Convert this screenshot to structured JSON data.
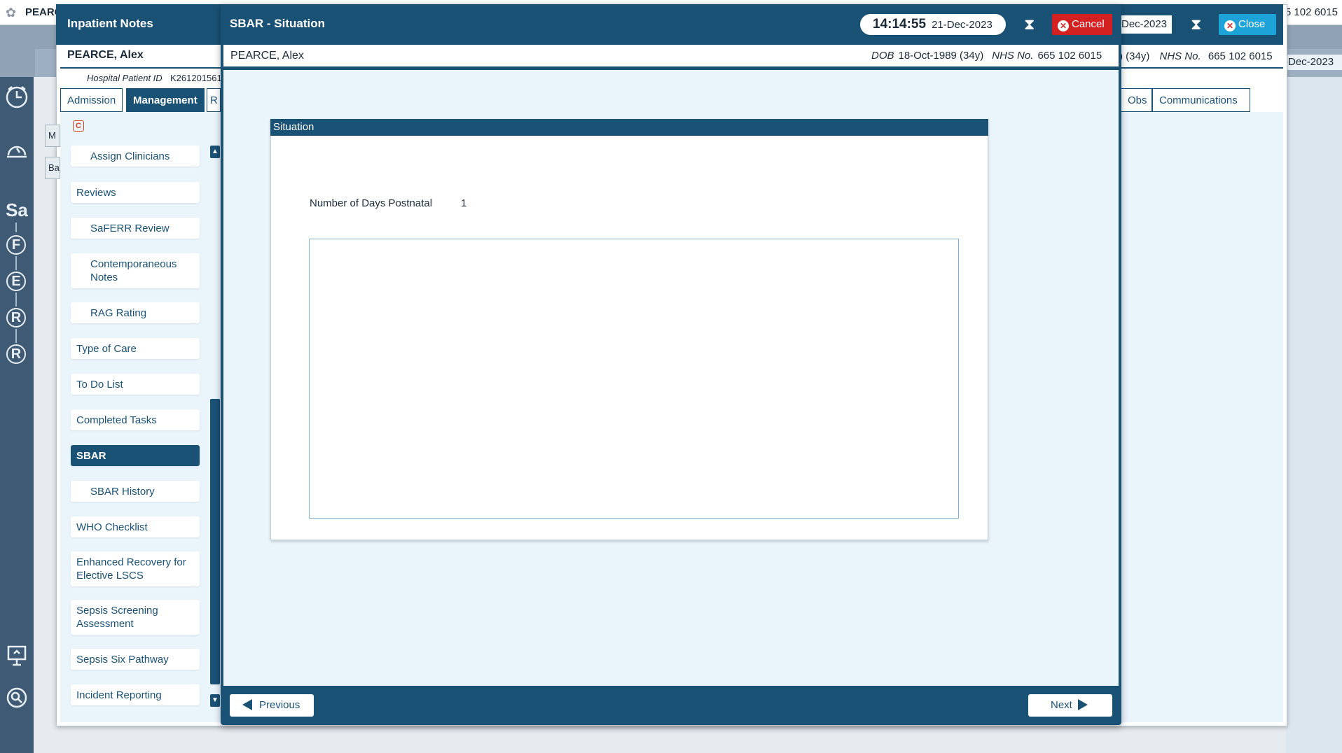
{
  "app_bar": {
    "patient_name": "PEARC",
    "nhs_right": "5 102 6015",
    "date_right": "-Dec-2023"
  },
  "rail": {
    "icons": [
      "clock-icon",
      "alarm-icon"
    ],
    "letters": [
      "Sa",
      "F",
      "E",
      "R",
      "R"
    ]
  },
  "inpatient": {
    "title": "Inpatient Notes",
    "patient_name": "PEARCE, Alex",
    "hospital_id_label": "Hospital Patient ID",
    "hospital_id_value": "K261201561",
    "tabs": [
      "Admission",
      "Management",
      "R"
    ],
    "tabs_right": [
      "Obs",
      "Communications"
    ],
    "date_partial": "Dec-2023",
    "age_partial": ") (34y)",
    "nhs_label": "NHS No.",
    "nhs_value": "665 102 6015",
    "close_label": "Close",
    "side_stubs": [
      "M",
      "Ba"
    ],
    "c_icon": "C"
  },
  "nav": {
    "items": [
      {
        "label": "Assign Clinicians",
        "sub": true
      },
      {
        "label": "Reviews",
        "sub": false
      },
      {
        "label": "SaFERR Review",
        "sub": true
      },
      {
        "label": "Contemporaneous Notes",
        "sub": true
      },
      {
        "label": "RAG Rating",
        "sub": true
      },
      {
        "label": "Type of Care",
        "sub": false
      },
      {
        "label": "To Do List",
        "sub": false
      },
      {
        "label": "Completed Tasks",
        "sub": false
      },
      {
        "label": "SBAR",
        "sub": false,
        "active": true
      },
      {
        "label": "SBAR History",
        "sub": true
      },
      {
        "label": "WHO Checklist",
        "sub": false
      },
      {
        "label": "Enhanced Recovery for Elective LSCS",
        "sub": false
      },
      {
        "label": "Sepsis Screening Assessment",
        "sub": false
      },
      {
        "label": "Sepsis Six Pathway",
        "sub": false
      },
      {
        "label": "Incident Reporting",
        "sub": false
      }
    ]
  },
  "modal": {
    "title": "SBAR - Situation",
    "time": "14:14:55",
    "date": "21-Dec-2023",
    "cancel_label": "Cancel",
    "patient_name": "PEARCE, Alex",
    "dob_label": "DOB",
    "dob_value": "18-Oct-1989 (34y)",
    "nhs_label": "NHS No.",
    "nhs_value": "665 102 6015",
    "section_title": "Situation",
    "days_postnatal_label": "Number of Days Postnatal",
    "days_postnatal_value": "1",
    "notes_value": "",
    "previous_label": "Previous",
    "next_label": "Next"
  },
  "colors": {
    "primary": "#1a5276",
    "cancel": "#d32020",
    "close": "#1ea3d8",
    "body_bg": "#eaf4fb"
  }
}
